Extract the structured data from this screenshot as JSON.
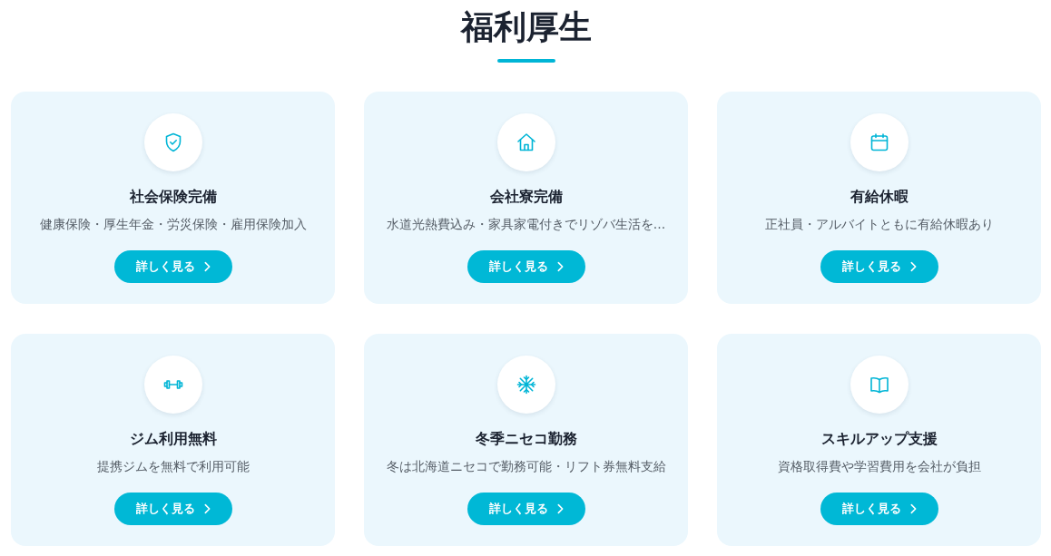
{
  "section": {
    "title": "福利厚生"
  },
  "benefits": [
    {
      "title": "社会保険完備",
      "description": "健康保険・厚生年金・労災保険・雇用保険加入",
      "button": "詳しく見る"
    },
    {
      "title": "会社寮完備",
      "description": "水道光熱費込み・家具家電付きでリゾバ生活を...",
      "button": "詳しく見る"
    },
    {
      "title": "有給休暇",
      "description": "正社員・アルバイトともに有給休暇あり",
      "button": "詳しく見る"
    },
    {
      "title": "ジム利用無料",
      "description": "提携ジムを無料で利用可能",
      "button": "詳しく見る"
    },
    {
      "title": "冬季ニセコ勤務",
      "description": "冬は北海道ニセコで勤務可能・リフト券無料支給",
      "button": "詳しく見る"
    },
    {
      "title": "スキルアップ支援",
      "description": "資格取得費や学習費用を会社が負担",
      "button": "詳しく見る"
    }
  ]
}
